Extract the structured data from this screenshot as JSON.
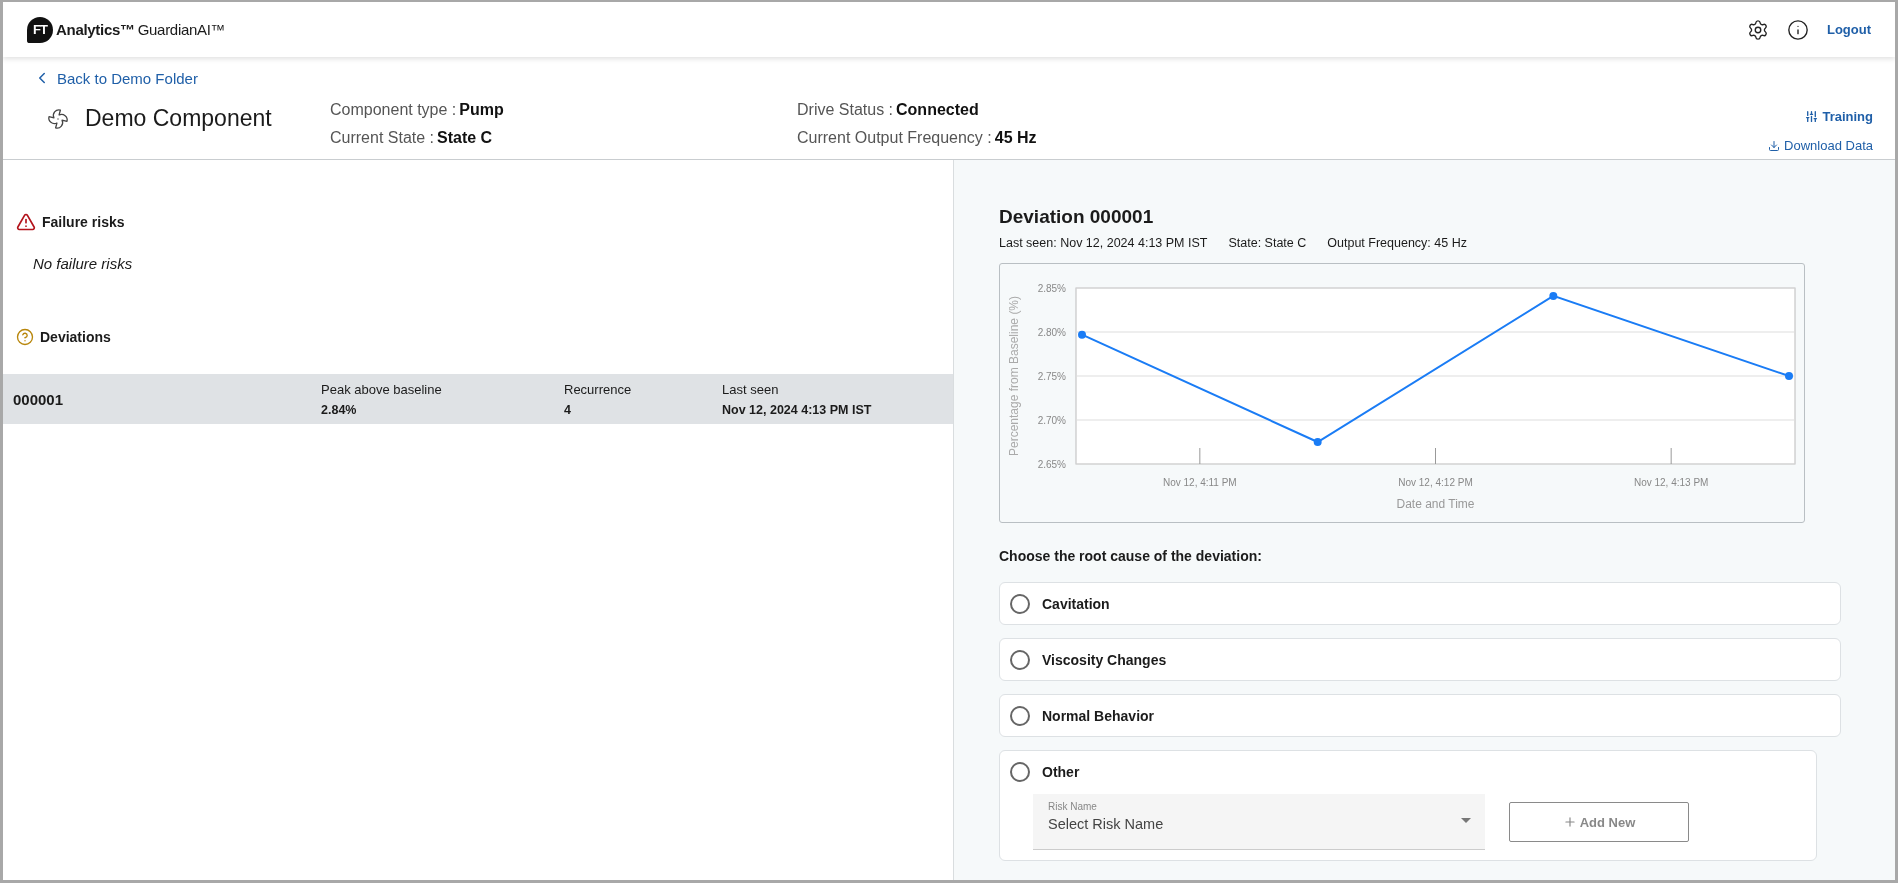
{
  "header": {
    "logo": {
      "mark": "FT",
      "brand": "Analytics™",
      "product": "GuardianAI™"
    },
    "logout": "Logout"
  },
  "back_link": "Back to Demo Folder",
  "component": {
    "title": "Demo Component",
    "fields": [
      {
        "label": "Component type :",
        "value": "Pump"
      },
      {
        "label": "Drive Status :",
        "value": "Connected"
      },
      {
        "label": "Current State :",
        "value": "State C"
      },
      {
        "label": "Current Output Frequency :",
        "value": "45 Hz"
      }
    ]
  },
  "actions": [
    {
      "kind": "training",
      "label": "Training"
    },
    {
      "kind": "download",
      "label": "Download Data"
    }
  ],
  "failure_risks": {
    "title": "Failure risks",
    "empty": "No failure risks"
  },
  "deviations": {
    "title": "Deviations",
    "rows": [
      {
        "id": "000001",
        "selected": true,
        "cells": [
          {
            "label": "Peak above baseline",
            "value": "2.84%"
          },
          {
            "label": "Recurrence",
            "value": "4"
          },
          {
            "label": "Last seen",
            "value": "Nov 12, 2024 4:13 PM IST"
          }
        ]
      }
    ]
  },
  "detail": {
    "title": "Deviation 000001",
    "meta": [
      "Last seen: Nov 12, 2024 4:13 PM IST",
      "State: State C",
      "Output Frequency: 45 Hz"
    ],
    "chart_data": {
      "type": "line",
      "xlabel": "Date and Time",
      "ylabel": "Percentage from Baseline (%)",
      "categories": [
        null,
        "Nov 12, 4:11 PM",
        null,
        "Nov 12, 4:12 PM",
        null,
        "Nov 12, 4:13 PM",
        null
      ],
      "series": [
        {
          "color": "#1a7cf5",
          "marker": "circle",
          "values": [
            2.797,
            null,
            2.675,
            null,
            2.841,
            null,
            2.75
          ]
        }
      ],
      "grid": true,
      "ylim": [
        2.65,
        2.85
      ],
      "yticks": [
        {
          "value": 2.65,
          "label": "2.65%"
        },
        {
          "value": 2.7,
          "label": "2.70%"
        },
        {
          "value": 2.75,
          "label": "2.75%"
        },
        {
          "value": 2.8,
          "label": "2.80%"
        },
        {
          "value": 2.85,
          "label": "2.85%"
        }
      ]
    },
    "question": "Choose the root cause of the deviation:",
    "options": [
      {
        "kind": "plain",
        "label": "Cavitation",
        "selected": false
      },
      {
        "kind": "plain",
        "label": "Viscosity Changes",
        "selected": false
      },
      {
        "kind": "plain",
        "label": "Normal Behavior",
        "selected": false
      },
      {
        "kind": "other",
        "label": "Other",
        "selected": false,
        "select": {
          "label": "Risk Name",
          "value": "Select Risk Name"
        },
        "button": "Add New"
      }
    ]
  }
}
